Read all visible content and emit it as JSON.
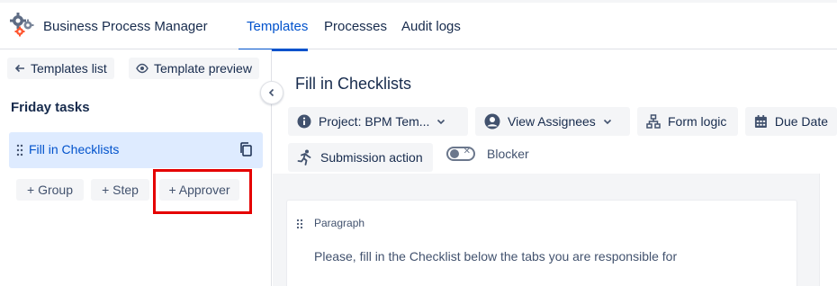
{
  "header": {
    "app_title": "Business Process Manager",
    "tabs": [
      {
        "label": "Templates",
        "active": true
      },
      {
        "label": "Processes",
        "active": false
      },
      {
        "label": "Audit logs",
        "active": false
      }
    ],
    "accent_color": "#0052cc"
  },
  "sidebar": {
    "back_label": "Templates list",
    "preview_label": "Template preview",
    "section_title": "Friday tasks",
    "steps": [
      {
        "label": "Fill in Checklists",
        "selected": true
      }
    ],
    "add_buttons": {
      "group": "+ Group",
      "step": "+ Step",
      "approver": "+ Approver"
    },
    "highlight_color": "#e50000"
  },
  "main": {
    "title": "Fill in Checklists",
    "toolbar": {
      "project": "Project: BPM Tem...",
      "assignees": "View Assignees",
      "form_logic": "Form logic",
      "due_date": "Due Date",
      "submission": "Submission action",
      "blocker": "Blocker",
      "blocker_on": false
    },
    "field": {
      "type": "Paragraph",
      "text": "Please, fill in the Checklist below the tabs you are responsible for"
    }
  }
}
